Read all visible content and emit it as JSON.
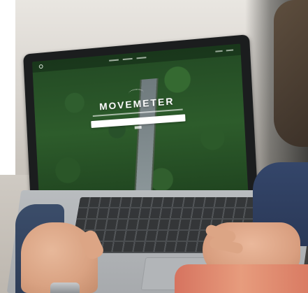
{
  "scene": {
    "subject": "laptop-on-table",
    "icons": [
      "laptop-icon",
      "search-bar-icon",
      "brand-logo-icon"
    ]
  },
  "website": {
    "hero_title": "MOVEMETER"
  },
  "colors": {
    "forest_green": "#2d5c2b",
    "laptop_body": "#b9bcbf",
    "keyboard": "#2a2c2e",
    "sleeve_blue": "#34466a",
    "skin": "#e7b89a",
    "shirt_coral": "#d6735f"
  }
}
